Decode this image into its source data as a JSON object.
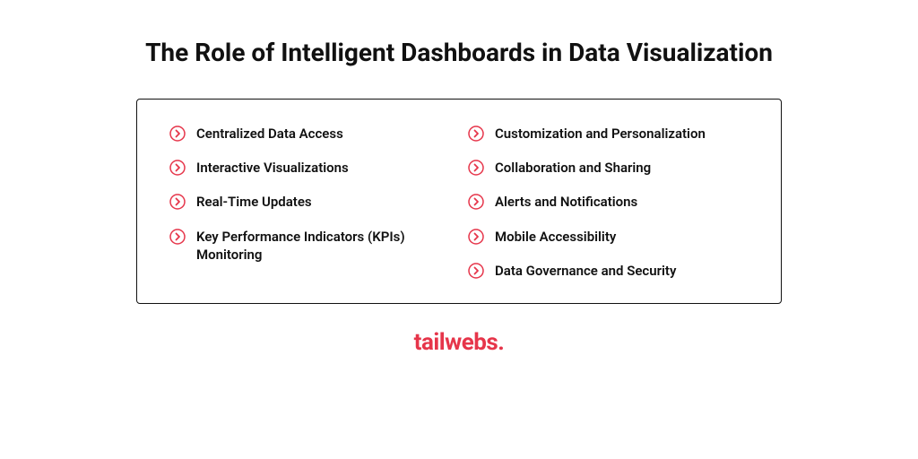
{
  "title": "The Role of Intelligent Dashboards in Data Visualization",
  "columns": {
    "left": [
      {
        "label": "Centralized Data Access"
      },
      {
        "label": "Interactive Visualizations"
      },
      {
        "label": "Real-Time Updates"
      },
      {
        "label": "Key Performance Indicators (KPIs) Monitoring"
      }
    ],
    "right": [
      {
        "label": "Customization and Personalization"
      },
      {
        "label": "Collaboration and Sharing"
      },
      {
        "label": "Alerts and Notifications"
      },
      {
        "label": "Mobile Accessibility"
      },
      {
        "label": "Data Governance and Security"
      }
    ]
  },
  "brand": "tailwebs.",
  "colors": {
    "accent": "#e6354a",
    "text": "#111111"
  }
}
